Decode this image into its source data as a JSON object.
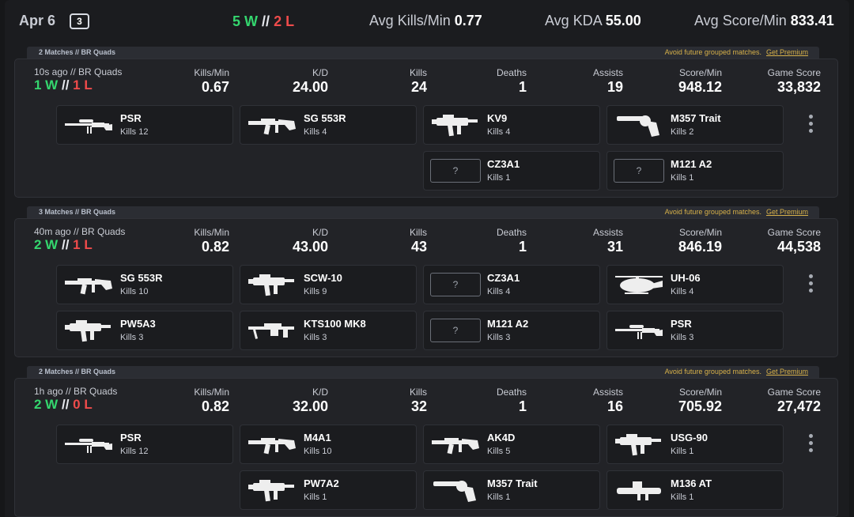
{
  "summary": {
    "date": "Apr 6",
    "count": "3",
    "wins": "5 W",
    "separator": "//",
    "losses": "2 L",
    "avg_kpm_label": "Avg Kills/Min",
    "avg_kpm": "0.77",
    "avg_kda_label": "Avg KDA",
    "avg_kda": "55.00",
    "avg_spm_label": "Avg Score/Min",
    "avg_spm": "833.41"
  },
  "labels": {
    "kpm": "Kills/Min",
    "kd": "K/D",
    "kills": "Kills",
    "deaths": "Deaths",
    "assists": "Assists",
    "spm": "Score/Min",
    "score": "Game Score",
    "promo_text": "Avoid future grouped matches.",
    "promo_link": "Get Premium",
    "kills_prefix": "Kills",
    "unknown_mark": "?"
  },
  "groups": [
    {
      "title": "2 Matches // BR Quads",
      "meta": "10s ago // BR Quads",
      "wins": "1 W",
      "sep": "//",
      "losses": "1 L",
      "kpm": "0.67",
      "kd": "24.00",
      "kills": "24",
      "deaths": "1",
      "assists": "19",
      "spm": "948.12",
      "score": "33,832",
      "weapons": [
        {
          "name": "PSR",
          "kills": "12",
          "icon": "sniper-rifle-icon"
        },
        {
          "name": "SG 553R",
          "kills": "4",
          "icon": "assault-rifle-icon"
        },
        {
          "name": "KV9",
          "kills": "4",
          "icon": "smg-icon"
        },
        {
          "name": "M357 Trait",
          "kills": "2",
          "icon": "revolver-icon"
        },
        null,
        null,
        {
          "name": "CZ3A1",
          "kills": "1",
          "icon": "unknown"
        },
        {
          "name": "M121 A2",
          "kills": "1",
          "icon": "unknown"
        }
      ]
    },
    {
      "title": "3 Matches // BR Quads",
      "meta": "40m ago // BR Quads",
      "wins": "2 W",
      "sep": "//",
      "losses": "1 L",
      "kpm": "0.82",
      "kd": "43.00",
      "kills": "43",
      "deaths": "1",
      "assists": "31",
      "spm": "846.19",
      "score": "44,538",
      "weapons": [
        {
          "name": "SG 553R",
          "kills": "10",
          "icon": "assault-rifle-icon"
        },
        {
          "name": "SCW-10",
          "kills": "9",
          "icon": "smg-icon"
        },
        {
          "name": "CZ3A1",
          "kills": "4",
          "icon": "unknown"
        },
        {
          "name": "UH-06",
          "kills": "4",
          "icon": "helicopter-icon"
        },
        {
          "name": "PW5A3",
          "kills": "3",
          "icon": "smg-icon"
        },
        {
          "name": "KTS100 MK8",
          "kills": "3",
          "icon": "lmg-icon"
        },
        {
          "name": "M121 A2",
          "kills": "3",
          "icon": "unknown"
        },
        {
          "name": "PSR",
          "kills": "3",
          "icon": "sniper-rifle-icon"
        }
      ]
    },
    {
      "title": "2 Matches // BR Quads",
      "meta": "1h ago // BR Quads",
      "wins": "2 W",
      "sep": "//",
      "losses": "0 L",
      "kpm": "0.82",
      "kd": "32.00",
      "kills": "32",
      "deaths": "1",
      "assists": "16",
      "spm": "705.92",
      "score": "27,472",
      "weapons": [
        {
          "name": "PSR",
          "kills": "12",
          "icon": "sniper-rifle-icon"
        },
        {
          "name": "M4A1",
          "kills": "10",
          "icon": "assault-rifle-icon"
        },
        {
          "name": "AK4D",
          "kills": "5",
          "icon": "assault-rifle-icon"
        },
        {
          "name": "USG-90",
          "kills": "1",
          "icon": "smg-icon"
        },
        null,
        {
          "name": "PW7A2",
          "kills": "1",
          "icon": "smg-icon"
        },
        {
          "name": "M357 Trait",
          "kills": "1",
          "icon": "revolver-icon"
        },
        {
          "name": "M136 AT",
          "kills": "1",
          "icon": "launcher-icon"
        }
      ]
    }
  ]
}
